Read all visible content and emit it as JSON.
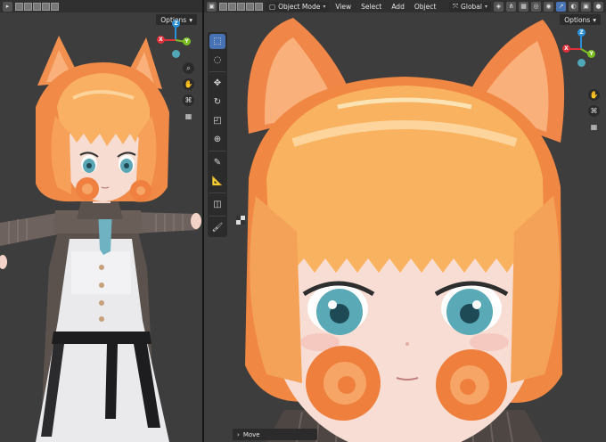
{
  "left_viewport": {
    "options_label": "Options",
    "gizmo": {
      "z": "Z",
      "x": "X",
      "y": "Y"
    },
    "nav_icons": [
      "zoom-icon",
      "hand-icon",
      "camera-icon",
      "grid-icon"
    ]
  },
  "right_viewport": {
    "mode_label": "Object Mode",
    "menus": [
      "View",
      "Select",
      "Add",
      "Object"
    ],
    "transform_orientation": "Global",
    "options_label": "Options",
    "gizmo": {
      "z": "Z",
      "x": "X",
      "y": "Y"
    },
    "tools": [
      "select-box-icon",
      "cursor-icon",
      "move-icon",
      "rotate-icon",
      "scale-icon",
      "transform-icon",
      "annotate-icon",
      "measure-icon",
      "add-cube-icon",
      "brush-icon"
    ],
    "status_panel": "Move"
  },
  "colors": {
    "viewport_bg": "#3d3d3d",
    "header_bg": "#303030",
    "active_blue": "#4772b3",
    "axis_x": "#e0303c",
    "axis_y": "#7bbf20",
    "axis_z": "#2a8fd9"
  }
}
